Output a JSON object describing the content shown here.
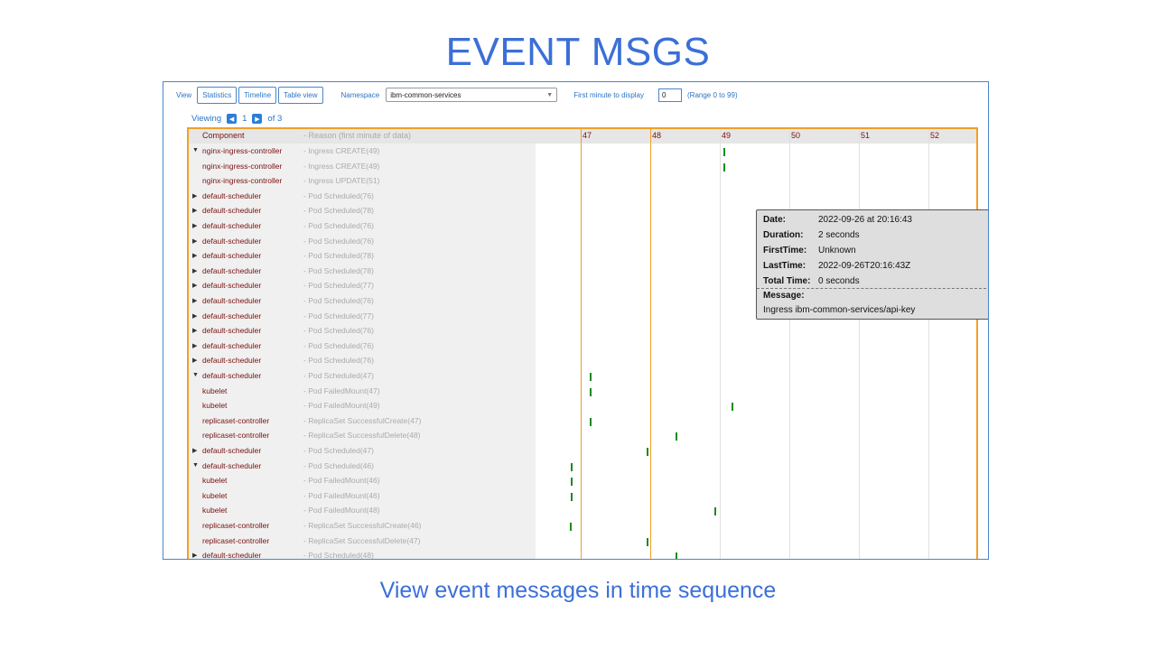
{
  "slide": {
    "title": "EVENT MSGS",
    "caption": "View event messages in time sequence"
  },
  "toolbar": {
    "view_label": "View",
    "buttons": [
      "Statistics",
      "Timeline",
      "Table view"
    ],
    "namespace_label": "Namespace",
    "namespace_value": "ibm-common-services",
    "first_minute_label": "First minute to display",
    "first_minute_value": "0",
    "range_text": "(Range 0 to 99)"
  },
  "pager": {
    "viewing_label": "Viewing",
    "current_page": "1",
    "of_text": "of 3"
  },
  "table": {
    "header_component": "Component",
    "header_reason": "- Reason (first minute of data)",
    "minute_ticks": [
      "47",
      "48",
      "49",
      "50",
      "51",
      "52"
    ],
    "rows": [
      {
        "toggle": "open",
        "component": "nginx-ingress-controller",
        "reason": "- Ingress CREATE(49)",
        "minute": 49.05
      },
      {
        "toggle": "",
        "component": "nginx-ingress-controller",
        "reason": "- Ingress CREATE(49)",
        "minute": 49.05
      },
      {
        "toggle": "",
        "component": "nginx-ingress-controller",
        "reason": "- Ingress UPDATE(51)",
        "minute": null
      },
      {
        "toggle": "closed",
        "component": "default-scheduler",
        "reason": "- Pod Scheduled(76)",
        "minute": null
      },
      {
        "toggle": "closed",
        "component": "default-scheduler",
        "reason": "- Pod Scheduled(78)",
        "minute": null
      },
      {
        "toggle": "closed",
        "component": "default-scheduler",
        "reason": "- Pod Scheduled(76)",
        "minute": null
      },
      {
        "toggle": "closed",
        "component": "default-scheduler",
        "reason": "- Pod Scheduled(76)",
        "minute": null
      },
      {
        "toggle": "closed",
        "component": "default-scheduler",
        "reason": "- Pod Scheduled(78)",
        "minute": null
      },
      {
        "toggle": "closed",
        "component": "default-scheduler",
        "reason": "- Pod Scheduled(78)",
        "minute": null
      },
      {
        "toggle": "closed",
        "component": "default-scheduler",
        "reason": "- Pod Scheduled(77)",
        "minute": null
      },
      {
        "toggle": "closed",
        "component": "default-scheduler",
        "reason": "- Pod Scheduled(76)",
        "minute": null
      },
      {
        "toggle": "closed",
        "component": "default-scheduler",
        "reason": "- Pod Scheduled(77)",
        "minute": null
      },
      {
        "toggle": "closed",
        "component": "default-scheduler",
        "reason": "- Pod Scheduled(76)",
        "minute": null
      },
      {
        "toggle": "closed",
        "component": "default-scheduler",
        "reason": "- Pod Scheduled(76)",
        "minute": null
      },
      {
        "toggle": "closed",
        "component": "default-scheduler",
        "reason": "- Pod Scheduled(76)",
        "minute": null
      },
      {
        "toggle": "open",
        "component": "default-scheduler",
        "reason": "- Pod Scheduled(47)",
        "minute": 47.13
      },
      {
        "toggle": "",
        "component": "kubelet",
        "reason": "- Pod FailedMount(47)",
        "minute": 47.13
      },
      {
        "toggle": "",
        "component": "kubelet",
        "reason": "- Pod FailedMount(49)",
        "minute": 49.17
      },
      {
        "toggle": "",
        "component": "replicaset-controller",
        "reason": "- ReplicaSet SuccessfulCreate(47)",
        "minute": 47.13
      },
      {
        "toggle": "",
        "component": "replicaset-controller",
        "reason": "- ReplicaSet SuccessfulDelete(48)",
        "minute": 48.37
      },
      {
        "toggle": "closed",
        "component": "default-scheduler",
        "reason": "- Pod Scheduled(47)",
        "minute": 47.95
      },
      {
        "toggle": "open",
        "component": "default-scheduler",
        "reason": "- Pod Scheduled(46)",
        "minute": 46.86
      },
      {
        "toggle": "",
        "component": "kubelet",
        "reason": "- Pod FailedMount(46)",
        "minute": 46.86
      },
      {
        "toggle": "",
        "component": "kubelet",
        "reason": "- Pod FailedMount(46)",
        "minute": 46.86
      },
      {
        "toggle": "",
        "component": "kubelet",
        "reason": "- Pod FailedMount(48)",
        "minute": 48.92
      },
      {
        "toggle": "",
        "component": "replicaset-controller",
        "reason": "- ReplicaSet SuccessfulCreate(46)",
        "minute": 46.84
      },
      {
        "toggle": "",
        "component": "replicaset-controller",
        "reason": "- ReplicaSet SuccessfulDelete(47)",
        "minute": 47.95
      },
      {
        "toggle": "closed",
        "component": "default-scheduler",
        "reason": "- Pod Scheduled(48)",
        "minute": 48.37
      }
    ]
  },
  "tooltip": {
    "fields": [
      {
        "key": "Date:",
        "value": "2022-09-26 at 20:16:43"
      },
      {
        "key": "Duration:",
        "value": "2 seconds"
      },
      {
        "key": "FirstTime:",
        "value": "Unknown"
      },
      {
        "key": "LastTime:",
        "value": "2022-09-26T20:16:43Z"
      },
      {
        "key": "Total Time:",
        "value": "0 seconds"
      }
    ],
    "message_label": "Message:",
    "message_value": "Ingress ibm-common-services/api-key"
  },
  "colors": {
    "accent": "#3b6fd8",
    "link": "#2a74c7",
    "component_text": "#7a1010",
    "event_mark": "#1e8a1e",
    "highlight_border": "#f0a028"
  }
}
